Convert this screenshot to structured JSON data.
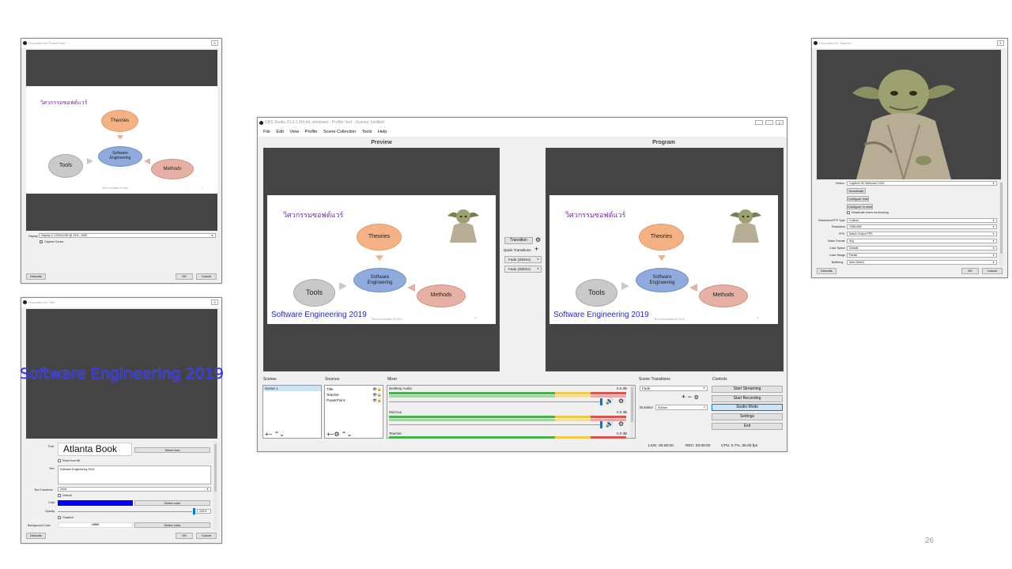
{
  "page_number": "26",
  "slide_content": {
    "title": "วิศวกรรมซอฟต์แวร์",
    "theories": "Theories",
    "software": "Software",
    "engineering": "Engineering",
    "tools": "Tools",
    "methods": "Methods",
    "footer": "วิศวกรรมซอฟต์แวร์ 2019",
    "overlay_text": "Software Engineering 2019",
    "page_dot": "∞"
  },
  "ppt_props": {
    "title": "Properties for 'PowerPoint'",
    "display_label": "Display",
    "display_value": "Display 4: 1920x1080 @ 1911,-1080",
    "capture_cursor": "Capture Cursor",
    "defaults": "Defaults",
    "ok": "OK",
    "cancel": "Cancel"
  },
  "text_props": {
    "title": "Properties for 'Title'",
    "font_label": "Font",
    "font_preview": "Atlanta Book",
    "select_font": "Select font",
    "read_from_file": "Read from file",
    "text_label": "Text",
    "text_value": "Software Engineering 2019",
    "text_transform_label": "Text Transform",
    "text_transform_value": "None",
    "vertical": "Vertical",
    "color_label": "Color",
    "select_color": "Select color",
    "opacity_label": "Opacity",
    "opacity_value": "100%",
    "gradient": "Gradient",
    "bg_color_label": "Background Color",
    "bg_color_value": "#ffffffff",
    "select_color2": "Select color",
    "defaults": "Defaults",
    "ok": "OK",
    "cancel": "Cancel",
    "accent_color": "#0000ff"
  },
  "teacher_props": {
    "title": "Properties for 'Teacher'",
    "device_label": "Device",
    "device_value": "Logitech HD Webcam C525",
    "deactivate": "Deactivate",
    "configure_video": "Configure Video",
    "configure_crossbar": "Configure Crossbar",
    "deactivate_when_not_showing": "Deactivate when not showing",
    "rows": [
      {
        "label": "Resolution/FPS Type",
        "value": "Custom"
      },
      {
        "label": "Resolution",
        "value": "1280x960"
      },
      {
        "label": "FPS",
        "value": "Match Output FPS"
      },
      {
        "label": "Video Format",
        "value": "Any"
      },
      {
        "label": "Color Space",
        "value": "Default"
      },
      {
        "label": "Color Range",
        "value": "Partial"
      },
      {
        "label": "Buffering",
        "value": "Auto-Detect"
      }
    ],
    "defaults": "Defaults",
    "ok": "OK",
    "cancel": "Cancel"
  },
  "obs": {
    "title": "OBS Studio 23.2.1 (64-bit, windows) - Profile: test - Scenes: Untitled",
    "menu": [
      "File",
      "Edit",
      "View",
      "Profile",
      "Scene Collection",
      "Tools",
      "Help"
    ],
    "preview_label": "Preview",
    "program_label": "Program",
    "transition_btn": "Transition",
    "quick_transitions": "Quick Transitions",
    "qt1": "Fade (300ms)",
    "qt2": "Fade (300ms)",
    "scenes_header": "Scenes",
    "scenes": [
      "Scene 1"
    ],
    "sources_header": "Sources",
    "sources": [
      "Title",
      "Teacher",
      "PowerPoint"
    ],
    "mixer_header": "Mixer",
    "mixer": [
      {
        "name": "Desktop Audio",
        "db": "0.0 dB"
      },
      {
        "name": "Mic/Aux",
        "db": "0.0 dB"
      },
      {
        "name": "Teacher",
        "db": "0.0 dB"
      }
    ],
    "transitions_header": "Scene Transitions",
    "transition_value": "Fade",
    "duration_label": "Duration",
    "duration_value": "300ms",
    "controls_header": "Controls",
    "controls": [
      "Start Streaming",
      "Start Recording",
      "Studio Mode",
      "Settings",
      "Exit"
    ],
    "status_live": "LIVE: 00:00:00",
    "status_rec": "REC: 00:00:00",
    "status_cpu": "CPU: 0.7%, 30.00 fps"
  }
}
